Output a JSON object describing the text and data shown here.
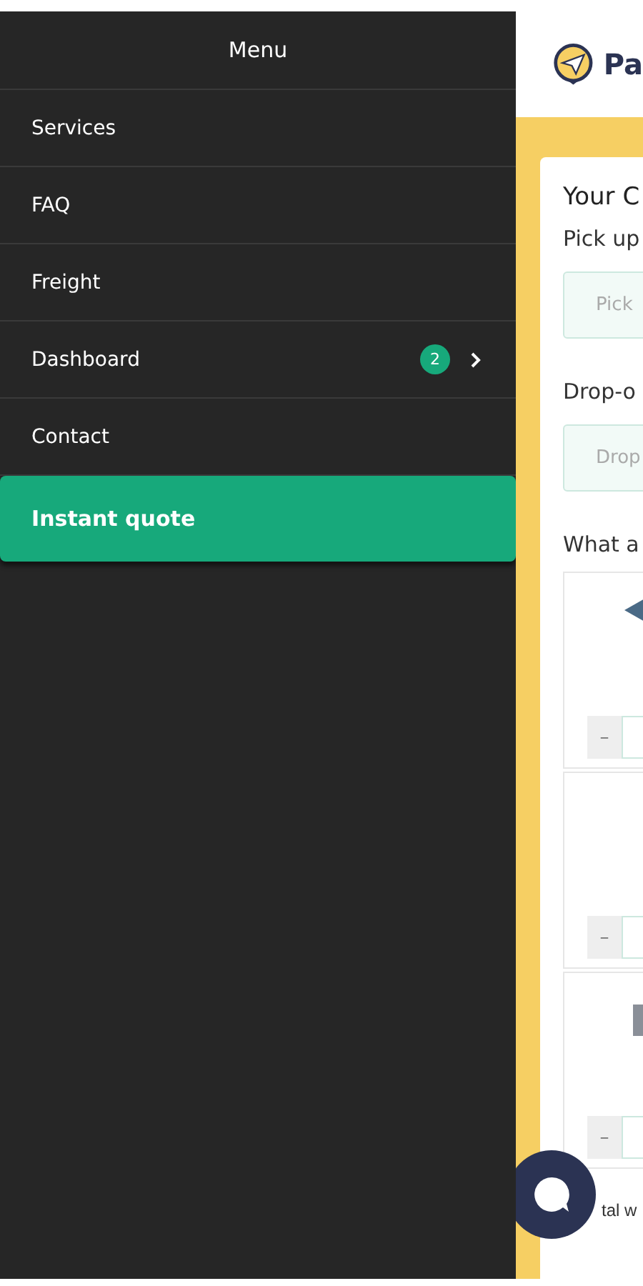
{
  "menu": {
    "title": "Menu",
    "items": [
      {
        "label": "Services",
        "kind": "link"
      },
      {
        "label": "FAQ",
        "kind": "link"
      },
      {
        "label": "Freight",
        "kind": "link"
      },
      {
        "label": "Dashboard",
        "kind": "link",
        "badge": "2",
        "has_children": true
      },
      {
        "label": "Contact",
        "kind": "link"
      },
      {
        "label": "Instant quote",
        "kind": "cta"
      }
    ]
  },
  "page": {
    "brand": "Pa",
    "form": {
      "title": "Your C",
      "fields": [
        {
          "label": "Pick up",
          "placeholder": "Pick"
        },
        {
          "label": "Drop-o",
          "placeholder": "Drop"
        }
      ],
      "question": "What a",
      "items": [
        {
          "kind": "diamond",
          "minus": "–"
        },
        {
          "kind": "blank",
          "minus": "–"
        },
        {
          "kind": "parcel",
          "minus": "–"
        }
      ],
      "footer_label": "tal w"
    }
  }
}
